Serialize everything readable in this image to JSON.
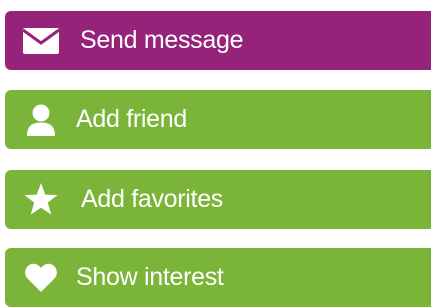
{
  "colors": {
    "purple": "#96237a",
    "green": "#7ab53a",
    "text": "#ffffff"
  },
  "buttons": {
    "send_message": {
      "label": "Send message",
      "icon": "envelope-icon"
    },
    "add_friend": {
      "label": "Add friend",
      "icon": "user-icon"
    },
    "add_favorites": {
      "label": "Add favorites",
      "icon": "star-icon"
    },
    "show_interest": {
      "label": "Show interest",
      "icon": "heart-icon"
    }
  }
}
